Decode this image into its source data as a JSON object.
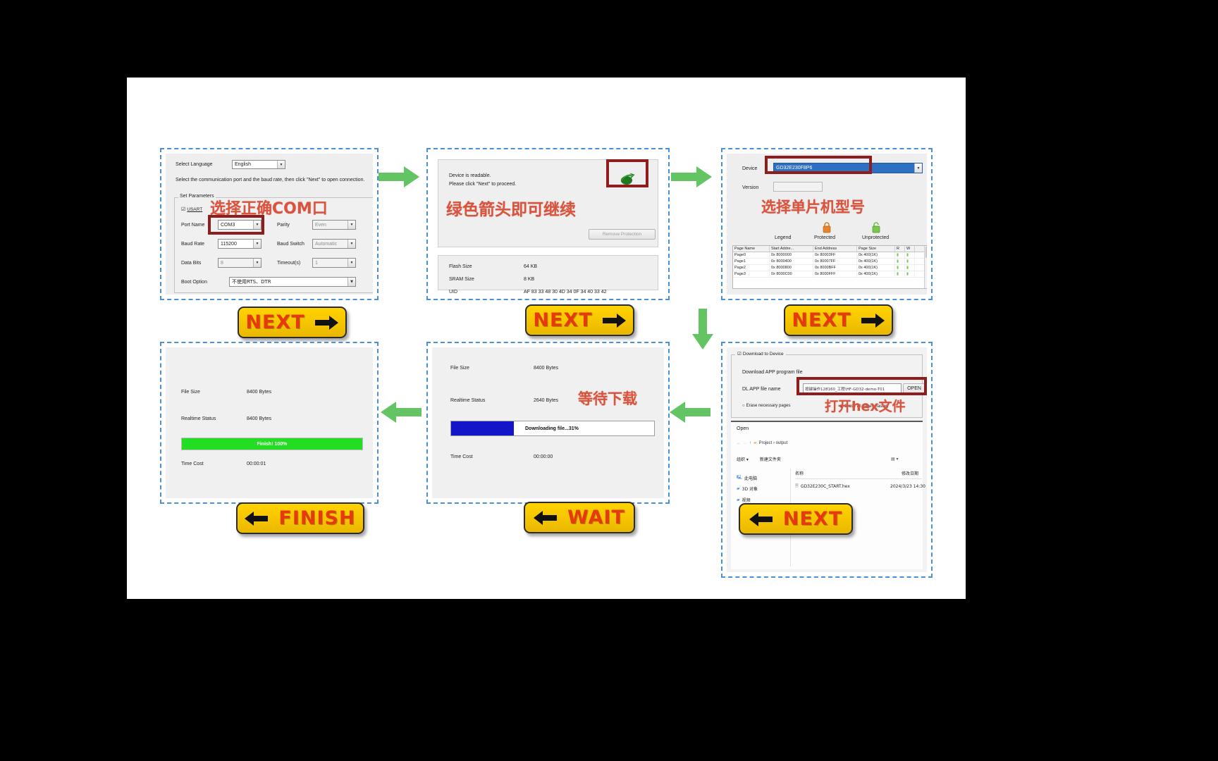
{
  "slide": {
    "background": "#ffffff",
    "page_background": "#000000",
    "accent_red": "#d9543f",
    "highlight_box": "#8f1d1d",
    "arrow_green": "#62c462",
    "button_yellow": "#ffd400",
    "button_text_red": "#e8380d"
  },
  "panel1": {
    "name": "serial-port-setup",
    "select_language_label": "Select Language",
    "language_value": "English",
    "instruction": "Select the communication port and the baud rate, then click \"Next\" to open connection.",
    "group_title": "Set Parameters",
    "uart_checkbox": "USART",
    "rows": [
      {
        "label": "Port Name",
        "value": "COM3",
        "label2": "Parity",
        "value2": "Even"
      },
      {
        "label": "Baud Rate",
        "value": "115200",
        "label2": "Baud Switch",
        "value2": "Automatic"
      },
      {
        "label": "Data Bits",
        "value": "8",
        "label2": "Timeout(s)",
        "value2": "1"
      }
    ],
    "boot_option_label": "Boot Option",
    "boot_option_value": "不使用RTS、DTR",
    "annotation": "选择正确COM口"
  },
  "panel2": {
    "name": "device-readable",
    "status_line1": "Device is readable.",
    "status_line2": "Please click \"Next\" to proceed.",
    "remove_protection_button": "Remove Protection",
    "info": [
      {
        "label": "Flash Size",
        "value": "64 KB"
      },
      {
        "label": "SRAM Size",
        "value": "8 KB"
      },
      {
        "label": "UID",
        "value": "AF 83 33 48 30 4D 34 0F 34 40 33 42"
      }
    ],
    "annotation": "绿色箭头即可继续",
    "arrow_icon": "green-arrow-icon"
  },
  "panel3": {
    "name": "device-selection",
    "device_label": "Device",
    "device_value": "GD32E230F8P6",
    "version_label": "Version",
    "version_value": "",
    "legend_label": "Legend",
    "protected_label": "Protected",
    "unprotected_label": "Unprotected",
    "annotation": "选择单片机型号",
    "table": {
      "columns": [
        "Page Name",
        "Start Addre...",
        "End Address",
        "Page Size",
        "R",
        "W"
      ],
      "rows": [
        [
          "Page0",
          "0x 8000000",
          "0x 80003FF",
          "0x 400(1K)",
          "",
          ""
        ],
        [
          "Page1",
          "0x 8000400",
          "0x 80007FF",
          "0x 400(1K)",
          "",
          ""
        ],
        [
          "Page2",
          "0x 8000800",
          "0x 8000BFF",
          "0x 400(1K)",
          "",
          ""
        ],
        [
          "Page3",
          "0x 8000C00",
          "0x 8000FFF",
          "0x 400(1K)",
          "",
          ""
        ]
      ]
    }
  },
  "panel4": {
    "name": "download-progress",
    "rows": [
      {
        "label": "File Size",
        "value": "8400 Bytes"
      },
      {
        "label": "Realtime Status",
        "value": "2640 Bytes"
      },
      {
        "label": "Time Cost",
        "value": "00:00:00"
      }
    ],
    "progress_percent": 31,
    "progress_text": "Downloading file...31%",
    "progress_color": "#1414c8",
    "annotation": "等待下载"
  },
  "panel5": {
    "name": "download-finished",
    "rows": [
      {
        "label": "File Size",
        "value": "8400 Bytes"
      },
      {
        "label": "Realtime Status",
        "value": "8400 Bytes"
      },
      {
        "label": "Time Cost",
        "value": "00:00:01"
      }
    ],
    "progress_percent": 100,
    "progress_text": "Finish!  100%",
    "progress_color": "#22dd22"
  },
  "panel6": {
    "name": "open-hex-file",
    "group_title": "Download to Device",
    "section_label": "Download APP program file",
    "file_label": "DL APP file name",
    "file_value": "按键操作128160_工程\\HF-GD32-demo-T01",
    "open_button": "OPEN",
    "erase_necessary": "Erase necessary pages",
    "erase_all": "Erase all pages (faster)",
    "annotation": "打开hex文件",
    "dialog": {
      "title": "Open",
      "breadcrumb": "Project  ›  output",
      "toolbar_organize": "组织 ▾",
      "toolbar_newfolder": "新建文件夹",
      "columns": [
        "名称",
        "修改日期"
      ],
      "sidebar": [
        {
          "icon": "computer-icon",
          "label": "此电脑"
        },
        {
          "icon": "folder-3d-icon",
          "label": "3D 对象"
        },
        {
          "icon": "video-icon",
          "label": "视频"
        }
      ],
      "files": [
        {
          "icon": "file-icon",
          "name": "GD32E230C_START.hex",
          "date": "2024/3/23 14:30"
        }
      ]
    }
  },
  "buttons": {
    "next1": {
      "label": "NEXT",
      "direction": "right"
    },
    "next2": {
      "label": "NEXT",
      "direction": "right"
    },
    "next3": {
      "label": "NEXT",
      "direction": "right"
    },
    "next4": {
      "label": "NEXT",
      "direction": "left"
    },
    "wait": {
      "label": "WAIT",
      "direction": "left"
    },
    "finish": {
      "label": "FINISH",
      "direction": "left"
    }
  }
}
